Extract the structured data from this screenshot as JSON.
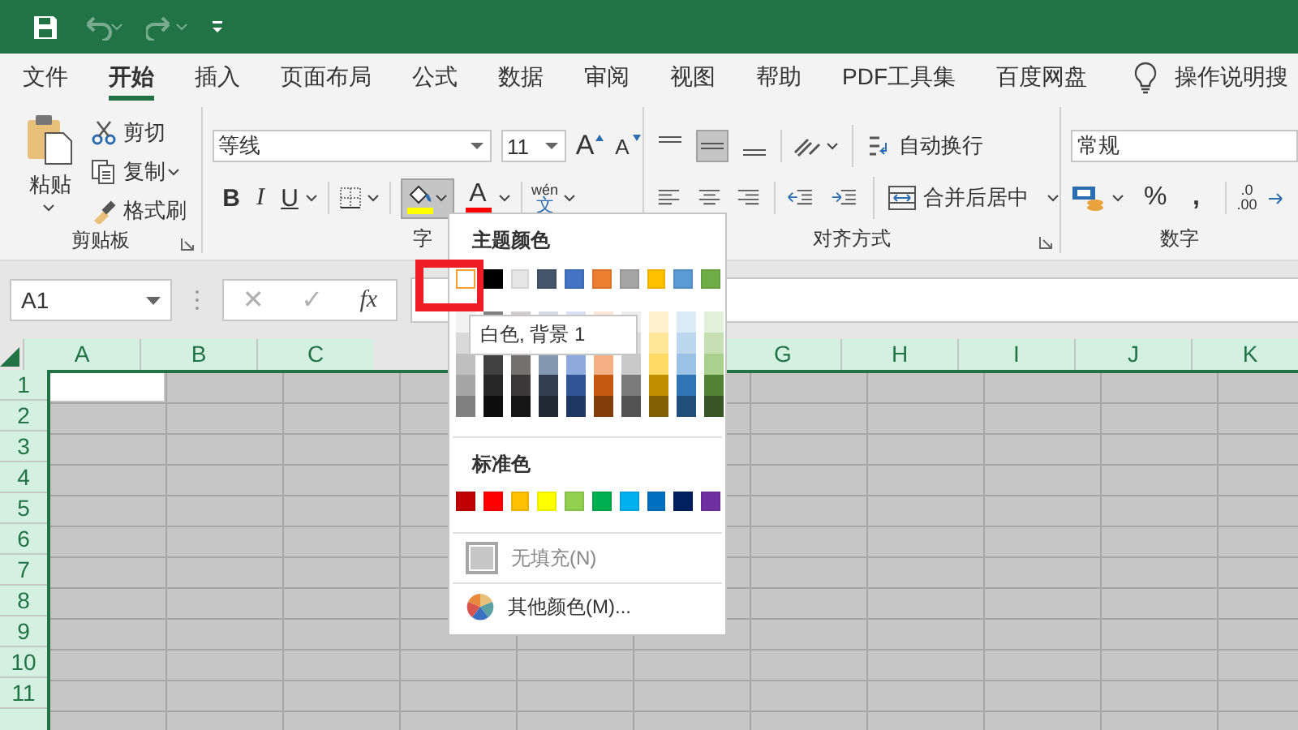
{
  "quick_access": [
    {
      "kind": "save",
      "disabled": false
    },
    {
      "kind": "undo",
      "disabled": true
    },
    {
      "kind": "redo",
      "disabled": true
    },
    {
      "kind": "customize",
      "disabled": false
    }
  ],
  "tabs": [
    {
      "label": "文件",
      "selected": false
    },
    {
      "label": "开始",
      "selected": true
    },
    {
      "label": "插入",
      "selected": false
    },
    {
      "label": "页面布局",
      "selected": false
    },
    {
      "label": "公式",
      "selected": false
    },
    {
      "label": "数据",
      "selected": false
    },
    {
      "label": "审阅",
      "selected": false
    },
    {
      "label": "视图",
      "selected": false
    },
    {
      "label": "帮助",
      "selected": false
    },
    {
      "label": "PDF工具集",
      "selected": false
    },
    {
      "label": "百度网盘",
      "selected": false
    }
  ],
  "tell_me": {
    "label": "操作说明搜"
  },
  "clipboard": {
    "label": "剪贴板",
    "paste": "粘贴",
    "cut": "剪切",
    "copy": "复制",
    "format_painter": "格式刷"
  },
  "font": {
    "label": "字",
    "font_name": "等线",
    "font_size": "11",
    "grow": "A",
    "shrink": "A",
    "bold": "B",
    "italic": "I",
    "underline": "U",
    "fill_pressed": true,
    "fill_swatch": {
      "color": "#ffff00"
    },
    "font_color_glyph": "A",
    "font_swatch": {
      "color": "#ff0000"
    },
    "phonetic_top": "wén",
    "phonetic_bottom": "文"
  },
  "alignment": {
    "label": "对齐方式",
    "vertical": [
      {
        "selected": false
      },
      {
        "selected": true
      },
      {
        "selected": false
      }
    ],
    "wrap_text": "自动换行",
    "merge_center": "合并后居中"
  },
  "number": {
    "label": "数字",
    "format": "常规",
    "percent": "%",
    "comma": ",",
    "decimal_top": ".0",
    "decimal_bottom": ".00"
  },
  "formula_bar": {
    "name_box": "A1",
    "cancel": "✕",
    "enter": "✓",
    "function": "fx"
  },
  "sheet": {
    "all_selected": true,
    "columns_left": [
      "A",
      "B",
      "C"
    ],
    "columns_right": [
      "G",
      "H",
      "I",
      "J",
      "K"
    ],
    "rows": [
      "1",
      "2",
      "3",
      "4",
      "5",
      "6",
      "7",
      "8",
      "9",
      "10",
      "11"
    ]
  },
  "fill_menu": {
    "theme_heading": "主题颜色",
    "theme_colors": [
      {
        "color": "#ffffff",
        "selected": true,
        "shades": [
          {
            "color": "#f2f2f2"
          },
          {
            "color": "#d9d9d9"
          },
          {
            "color": "#bfbfbf"
          },
          {
            "color": "#a6a6a6"
          },
          {
            "color": "#808080"
          }
        ]
      },
      {
        "color": "#000000",
        "selected": false,
        "under_tooltip": true,
        "shades": [
          {
            "color": "#7f7f7f"
          },
          {
            "color": "#404040"
          },
          {
            "color": "#262626"
          },
          {
            "color": "#0d0d0d"
          }
        ]
      },
      {
        "color": "#e7e6e6",
        "selected": false,
        "under_tooltip": true,
        "shades": [
          {
            "color": "#d0cece"
          },
          {
            "color": "#757171"
          },
          {
            "color": "#3a3838"
          },
          {
            "color": "#171616"
          }
        ]
      },
      {
        "color": "#44546a",
        "selected": false,
        "under_tooltip": true,
        "shades": [
          {
            "color": "#d6dce4"
          },
          {
            "color": "#8497b0"
          },
          {
            "color": "#333f4f"
          },
          {
            "color": "#222b35"
          }
        ]
      },
      {
        "color": "#4472c4",
        "selected": false,
        "under_tooltip": true,
        "shades": [
          {
            "color": "#d9e1f2"
          },
          {
            "color": "#8ea9db"
          },
          {
            "color": "#305496"
          },
          {
            "color": "#203764"
          }
        ]
      },
      {
        "color": "#ed7d31",
        "selected": false,
        "under_tooltip": true,
        "shades": [
          {
            "color": "#fce4d6"
          },
          {
            "color": "#f4b084"
          },
          {
            "color": "#c65911"
          },
          {
            "color": "#833c0c"
          }
        ]
      },
      {
        "color": "#a5a5a5",
        "selected": false,
        "shades": [
          {
            "color": "#ededed"
          },
          {
            "color": "#dbdbdb"
          },
          {
            "color": "#c9c9c9"
          },
          {
            "color": "#7b7b7b"
          },
          {
            "color": "#525252"
          }
        ]
      },
      {
        "color": "#ffc000",
        "selected": false,
        "shades": [
          {
            "color": "#fff2cc"
          },
          {
            "color": "#ffe699"
          },
          {
            "color": "#ffd966"
          },
          {
            "color": "#bf8f00"
          },
          {
            "color": "#806000"
          }
        ]
      },
      {
        "color": "#5b9bd5",
        "selected": false,
        "shades": [
          {
            "color": "#ddebf7"
          },
          {
            "color": "#bdd7ee"
          },
          {
            "color": "#9bc2e6"
          },
          {
            "color": "#2f75b5"
          },
          {
            "color": "#1f4e78"
          }
        ]
      },
      {
        "color": "#70ad47",
        "selected": false,
        "shades": [
          {
            "color": "#e2efda"
          },
          {
            "color": "#c6e0b4"
          },
          {
            "color": "#a9d08e"
          },
          {
            "color": "#548235"
          },
          {
            "color": "#375623"
          }
        ]
      }
    ],
    "standard_heading": "标准色",
    "standard_colors": [
      {
        "color": "#c00000",
        "selected": false
      },
      {
        "color": "#ff0000",
        "selected": false
      },
      {
        "color": "#ffc000",
        "selected": false
      },
      {
        "color": "#ffff00",
        "selected": false
      },
      {
        "color": "#92d050",
        "selected": false
      },
      {
        "color": "#00b050",
        "selected": false
      },
      {
        "color": "#00b0f0",
        "selected": false
      },
      {
        "color": "#0070c0",
        "selected": false
      },
      {
        "color": "#002060",
        "selected": false
      },
      {
        "color": "#7030a0",
        "selected": false
      }
    ],
    "no_fill": {
      "label": "无填充(N)",
      "disabled": true
    },
    "more_colors": "其他颜色(M)...",
    "tooltip": "白色, 背景 1"
  }
}
